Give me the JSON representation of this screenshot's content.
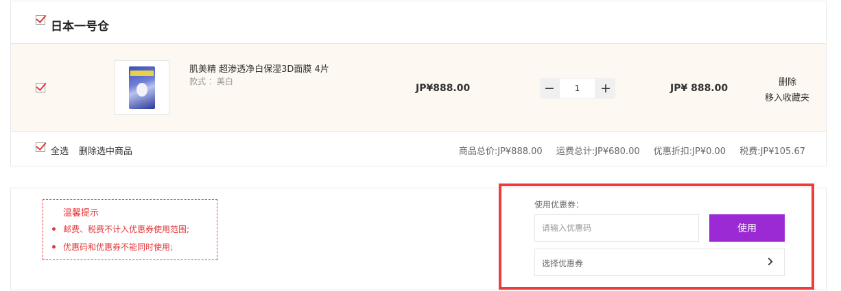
{
  "warehouse": {
    "title": "日本一号仓",
    "checked": true
  },
  "item": {
    "name": "肌美精 超渗透净白保湿3D面膜 4片",
    "spec": "款式 ：美白",
    "unit_price": "JP¥888.00",
    "quantity": "1",
    "subtotal": "JP¥ 888.00",
    "checked": true,
    "actions": {
      "delete": "删除",
      "favorite": "移入收藏夹"
    },
    "qty_controls": {
      "minus": "−",
      "plus": "+"
    }
  },
  "summary": {
    "select_all": "全选",
    "delete_selected": "删除选中商品",
    "goods_total": "商品总价:JP¥888.00",
    "shipping_total": "运费总计:JP¥680.00",
    "discount": "优惠折扣:JP¥0.00",
    "tax": "税费:JP¥105.67"
  },
  "tips": {
    "title": "温馨提示",
    "items": [
      "邮费、税费不计入优惠券使用范围;",
      "优惠码和优惠券不能同时使用;"
    ]
  },
  "coupon": {
    "label": "使用优惠券：",
    "input_value": "",
    "input_placeholder": "请输入优惠码",
    "apply_label": "使用",
    "select_label": "选择优惠券"
  },
  "colors": {
    "accent_red": "#e4393c",
    "apply_purple": "#9c2ad4",
    "highlight_border": "#ef3b3b",
    "item_row_bg": "#fdf8f1"
  }
}
